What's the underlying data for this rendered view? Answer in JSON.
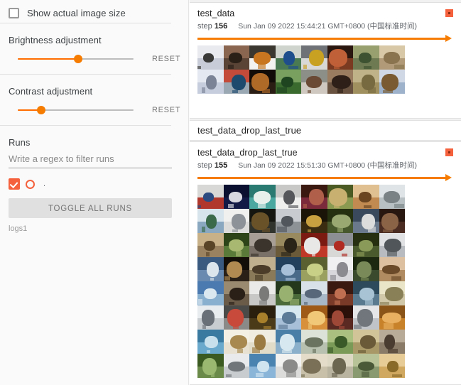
{
  "sidebar": {
    "show_actual_size": {
      "label": "Show actual image size",
      "checked": false
    },
    "brightness": {
      "title": "Brightness adjustment",
      "reset_label": "RESET",
      "value_pct": 52
    },
    "contrast": {
      "title": "Contrast adjustment",
      "reset_label": "RESET",
      "value_pct": 20
    },
    "runs": {
      "title": "Runs",
      "filter_placeholder": "Write a regex to filter runs",
      "filter_value": "",
      "run_dot_label": ".",
      "toggle_all_label": "TOGGLE ALL RUNS",
      "logs_label": "logs1"
    }
  },
  "main": {
    "section_header": "test_data_drop_last_true",
    "cards": [
      {
        "title": "test_data",
        "step_label": "step",
        "step_value": "156",
        "timestamp": "Sun Jan 09 2022 15:44:21 GMT+0800 (中国标准时间)",
        "grid_columns": 8,
        "grid_rows": 2
      },
      {
        "title": "test_data_drop_last_true",
        "step_label": "step",
        "step_value": "155",
        "timestamp": "Sun Jan 09 2022 15:51:30 GMT+0800 (中国标准时间)",
        "grid_columns": 8,
        "grid_rows": 8
      }
    ]
  },
  "colors": {
    "accent_orange": "#f57c00",
    "marker_orange": "#f4613c",
    "sidebar_bg": "#fafafa",
    "panel_bg": "#f1f1f1",
    "card_bg": "#ffffff",
    "text_primary": "#212121",
    "text_secondary": "#5f6368"
  },
  "grids": {
    "top": [
      {
        "a": "#c8ccd8",
        "b": "#3a3a38",
        "c": "#e8eaf0"
      },
      {
        "a": "#5a4436",
        "b": "#2a2018",
        "c": "#8a6650"
      },
      {
        "a": "#f3f3f1",
        "b": "#c8761f",
        "c": "#3a3630"
      },
      {
        "a": "#4a7a52",
        "b": "#1f4e8c",
        "c": "#cfd4cc"
      },
      {
        "a": "#d8d8d6",
        "b": "#c8a022",
        "c": "#6f7276"
      },
      {
        "a": "#7a3a22",
        "b": "#c06038",
        "c": "#2a1810"
      },
      {
        "a": "#6d7a52",
        "b": "#3d5230",
        "c": "#98a070"
      },
      {
        "a": "#b09a78",
        "b": "#8a7450",
        "c": "#d8c8a8"
      },
      {
        "a": "#c6cede",
        "b": "#7a8496",
        "c": "#e4e8f0"
      },
      {
        "a": "#9aa8b4",
        "b": "#1e4a6e",
        "c": "#c44a3a"
      },
      {
        "a": "#2a1d14",
        "b": "#b06a28",
        "c": "#120c08"
      },
      {
        "a": "#3a6a2e",
        "b": "#1e4420",
        "c": "#7aa060"
      },
      {
        "a": "#cfc8c0",
        "b": "#6a4a34",
        "c": "#8c8e88"
      },
      {
        "a": "#6a5240",
        "b": "#2e2018",
        "c": "#9a7c60"
      },
      {
        "a": "#a09060",
        "b": "#786a40",
        "c": "#c0b288"
      },
      {
        "a": "#9fb2cc",
        "b": "#7a5a30",
        "c": "#cfd8e4"
      }
    ],
    "bottom": [
      {
        "a": "#b0372c",
        "b": "#2a4a80",
        "c": "#d8d8d6"
      },
      {
        "a": "#141a46",
        "b": "#d8d8e0",
        "c": "#0c1030"
      },
      {
        "a": "#4aa8a0",
        "b": "#e8f0ec",
        "c": "#2a7a72"
      },
      {
        "a": "#efefed",
        "b": "#55565a",
        "c": "#c8c8c6"
      },
      {
        "a": "#7a2a3a",
        "b": "#b0604a",
        "c": "#3a1a10"
      },
      {
        "a": "#8a9a50",
        "b": "#c8b070",
        "c": "#4a5a22"
      },
      {
        "a": "#c08a50",
        "b": "#6a4420",
        "c": "#e0c090"
      },
      {
        "a": "#b8c0c4",
        "b": "#7a8286",
        "c": "#dfe4e6"
      },
      {
        "a": "#8aa8c0",
        "b": "#3a6a4a",
        "c": "#d8e4ec"
      },
      {
        "a": "#dcdcda",
        "b": "#8c9298",
        "c": "#f0f0ee"
      },
      {
        "a": "#30322c",
        "b": "#6a5228",
        "c": "#14160f"
      },
      {
        "a": "#8c9296",
        "b": "#50565c",
        "c": "#c8ccd0"
      },
      {
        "a": "#3a2c10",
        "b": "#c8a040",
        "c": "#1a1408"
      },
      {
        "a": "#46582c",
        "b": "#98a870",
        "c": "#24300f"
      },
      {
        "a": "#6a7a8c",
        "b": "#dcdcdc",
        "c": "#3a4a5c"
      },
      {
        "a": "#4a2c22",
        "b": "#8a6246",
        "c": "#281610"
      },
      {
        "a": "#9a8260",
        "b": "#5a4428",
        "c": "#c8b088"
      },
      {
        "a": "#5a7a3a",
        "b": "#a8b870",
        "c": "#2c4418"
      },
      {
        "a": "#7a7268",
        "b": "#3a342c",
        "c": "#a8a096"
      },
      {
        "a": "#6a5a3a",
        "b": "#2a2418",
        "c": "#9a8a60"
      },
      {
        "a": "#c03828",
        "b": "#e8e8e6",
        "c": "#7a1a10"
      },
      {
        "a": "#d8d8d6",
        "b": "#b02a22",
        "c": "#8c9094"
      },
      {
        "a": "#4a5a2c",
        "b": "#8a9a58",
        "c": "#263010"
      },
      {
        "a": "#b8bcc0",
        "b": "#50565a",
        "c": "#e0e2e4"
      },
      {
        "a": "#6a8ab0",
        "b": "#dce4ec",
        "c": "#3a5a80"
      },
      {
        "a": "#2a2018",
        "b": "#b08a50",
        "c": "#140e08"
      },
      {
        "a": "#8a7a5a",
        "b": "#4a3c28",
        "c": "#c0b090"
      },
      {
        "a": "#4a6a8a",
        "b": "#a8c0d8",
        "c": "#22405c"
      },
      {
        "a": "#9aa060",
        "b": "#c8d088",
        "c": "#5a6030"
      },
      {
        "a": "#d8d8dc",
        "b": "#8a8a90",
        "c": "#f0f0f2"
      },
      {
        "a": "#3a4a2c",
        "b": "#7a8a58",
        "c": "#1c2810"
      },
      {
        "a": "#b08a60",
        "b": "#6a4a28",
        "c": "#dcc0a0"
      },
      {
        "a": "#8ab0d0",
        "b": "#dce8f0",
        "c": "#4a7ab0"
      },
      {
        "a": "#6a5a48",
        "b": "#2a2018",
        "c": "#9a8a70"
      },
      {
        "a": "#c8c8c6",
        "b": "#7a7a78",
        "c": "#eaeae8"
      },
      {
        "a": "#4a6a3a",
        "b": "#98b070",
        "c": "#24381c"
      },
      {
        "a": "#a8b8c8",
        "b": "#58687a",
        "c": "#d8e0e8"
      },
      {
        "a": "#7a3a28",
        "b": "#c07050",
        "c": "#3a1a10"
      },
      {
        "a": "#5a7a90",
        "b": "#a8c4d4",
        "c": "#2c4a5c"
      },
      {
        "a": "#d0c8a8",
        "b": "#8a8058",
        "c": "#eae4c8"
      },
      {
        "a": "#c8cdd2",
        "b": "#6a7078",
        "c": "#e8ecef"
      },
      {
        "a": "#8a8a88",
        "b": "#c84a3a",
        "c": "#4a4a48"
      },
      {
        "a": "#4a3a18",
        "b": "#a8802c",
        "c": "#2a1e0c"
      },
      {
        "a": "#a8c0d8",
        "b": "#5a7a96",
        "c": "#d8e8f0"
      },
      {
        "a": "#d8903a",
        "b": "#f0c878",
        "c": "#a05a18"
      },
      {
        "a": "#5a2a22",
        "b": "#a04838",
        "c": "#2a1008"
      },
      {
        "a": "#c0c4c8",
        "b": "#70767c",
        "c": "#e4e6e8"
      },
      {
        "a": "#c8822a",
        "b": "#e8b060",
        "c": "#8a5418"
      },
      {
        "a": "#6aa8cc",
        "b": "#c8e0ec",
        "c": "#3a7aa0"
      },
      {
        "a": "#e8e0d0",
        "b": "#a88a50",
        "c": "#f4f0e4"
      },
      {
        "a": "#e0dcc8",
        "b": "#9a7a40",
        "c": "#f0ece0"
      },
      {
        "a": "#8ab0cc",
        "b": "#d8e8f0",
        "c": "#4a80a8"
      },
      {
        "a": "#b8c0b0",
        "b": "#6a7260",
        "c": "#dde2d8"
      },
      {
        "a": "#7a9a58",
        "b": "#3a5a28",
        "c": "#aac080"
      },
      {
        "a": "#a89868",
        "b": "#6a5a38",
        "c": "#d0c498"
      },
      {
        "a": "#8a7a68",
        "b": "#4a3c30",
        "c": "#b8ac98"
      },
      {
        "a": "#6a8a4a",
        "b": "#9ab870",
        "c": "#3a5a22"
      },
      {
        "a": "#c8cccf",
        "b": "#70767a",
        "c": "#e8eaec"
      },
      {
        "a": "#8ab4d8",
        "b": "#d0e4f0",
        "c": "#4a82b0"
      },
      {
        "a": "#dcdcda",
        "b": "#8a8a88",
        "c": "#f2f2f0"
      },
      {
        "a": "#c8c0a8",
        "b": "#7a7058",
        "c": "#e4dcc8"
      },
      {
        "a": "#b8b4a0",
        "b": "#6a6650",
        "c": "#dcd8c4"
      },
      {
        "a": "#8a9a70",
        "b": "#4a5a38",
        "c": "#b8c498"
      },
      {
        "a": "#d0a860",
        "b": "#8a6a28",
        "c": "#e8cc98"
      }
    ]
  }
}
